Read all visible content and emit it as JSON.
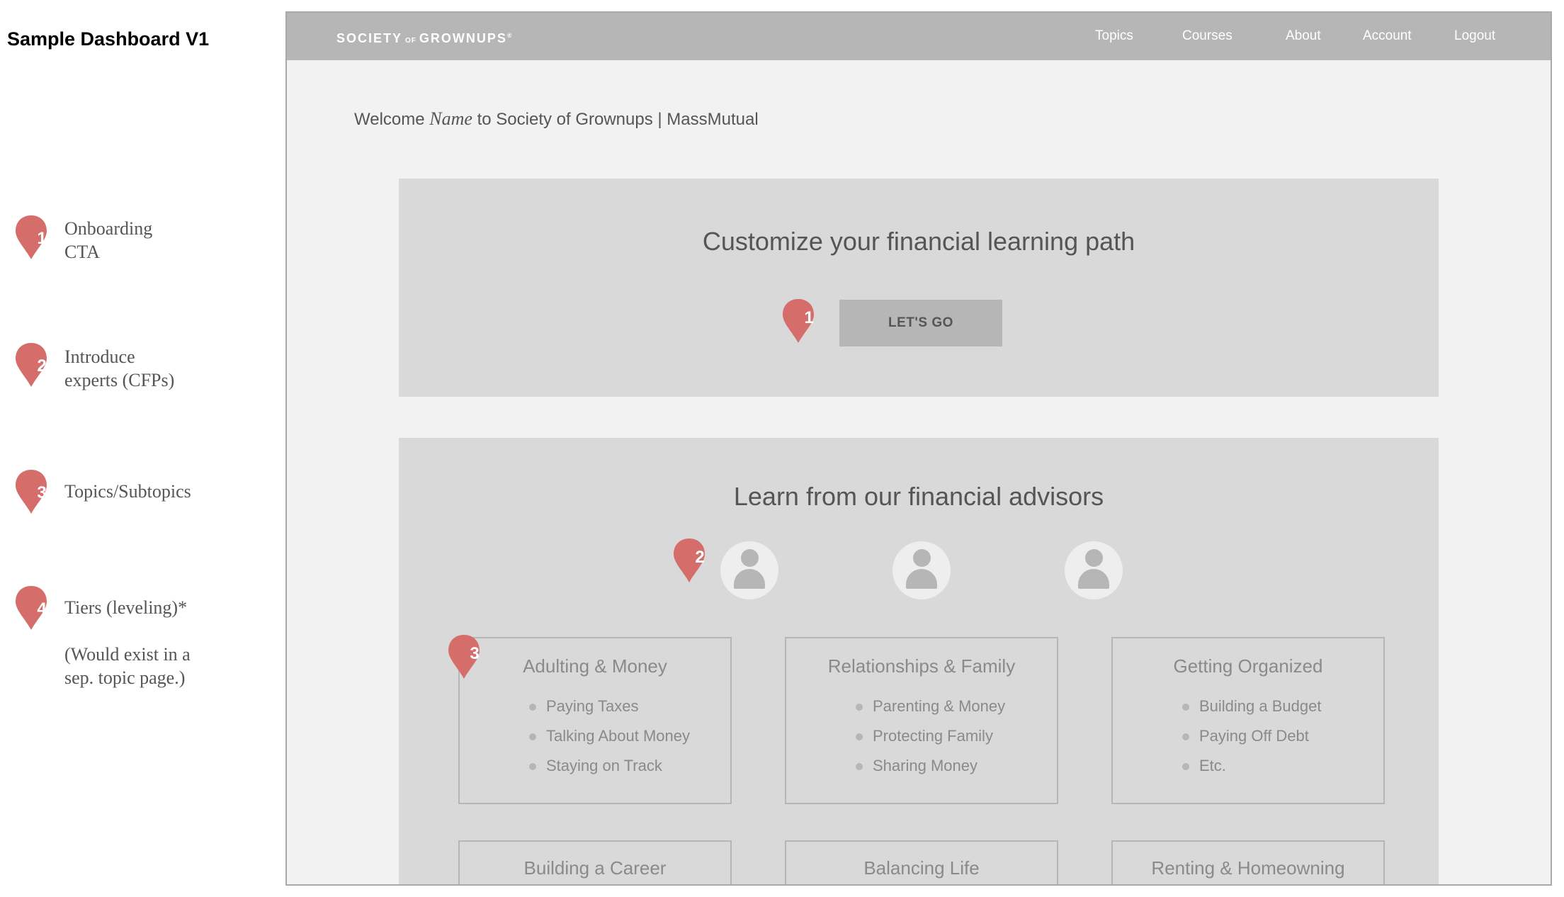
{
  "doc_title": "Sample Dashboard V1",
  "colors": {
    "marker": "#d56d6a",
    "nav_bg": "#b6b6b6",
    "panel_bg": "#d9d9d9",
    "page_bg": "#f2f2f2"
  },
  "legend": [
    {
      "number": "1",
      "text": "Onboarding\nCTA"
    },
    {
      "number": "2",
      "text": "Introduce\nexperts (CFPs)"
    },
    {
      "number": "3",
      "text": "Topics/Subtopics"
    },
    {
      "number": "4",
      "text": "Tiers (leveling)*\n\n(Would exist in a\nsep. topic page.)"
    }
  ],
  "nav": {
    "logo_left": "SOCIETY",
    "logo_of": "OF",
    "logo_right": "GROWNUPS",
    "logo_reg": "®",
    "items": [
      "Topics",
      "Courses",
      "About",
      "Account",
      "Logout"
    ]
  },
  "welcome": {
    "prefix": "Welcome ",
    "name": "Name",
    "suffix": " to Society of Grownups | MassMutual"
  },
  "cta_panel": {
    "title": "Customize your financial learning path",
    "button_label": "LET'S GO",
    "marker": "1"
  },
  "advisors_panel": {
    "title": "Learn from our financial advisors",
    "marker": "2",
    "avatars": [
      "person-icon",
      "person-icon",
      "person-icon"
    ]
  },
  "topics_marker": "3",
  "topics": [
    {
      "title": "Adulting & Money",
      "items": [
        "Paying Taxes",
        "Talking About Money",
        "Staying on Track"
      ]
    },
    {
      "title": "Relationships & Family",
      "items": [
        "Parenting & Money",
        "Protecting Family",
        "Sharing Money"
      ]
    },
    {
      "title": "Getting Organized",
      "items": [
        "Building a Budget",
        "Paying Off Debt",
        "Etc."
      ]
    }
  ],
  "more_topics": [
    "Building a Career",
    "Balancing Life",
    "Renting & Homeowning"
  ]
}
